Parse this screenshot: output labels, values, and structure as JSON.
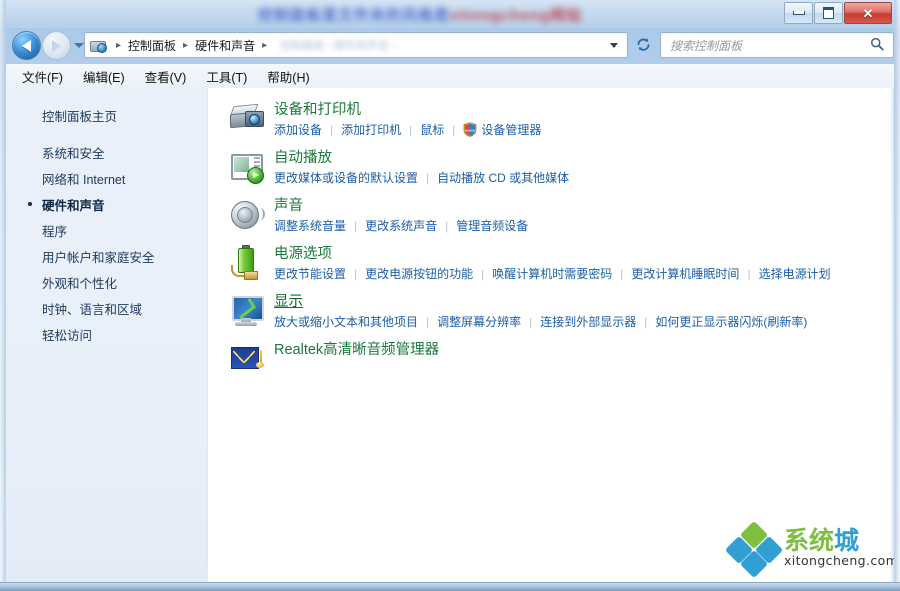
{
  "window": {
    "title_watermark_part1": "控制面板里文件夹的风格是",
    "title_watermark_part2": "xitongcheng网站",
    "minimize_label": "最小化",
    "maximize_label": "最大化",
    "close_label": "✕"
  },
  "nav": {
    "back_label": "后退",
    "forward_label": "前进",
    "history_label": "最近浏览的位置",
    "refresh_label": "刷新",
    "breadcrumbs": [
      "控制面板",
      "硬件和声音"
    ],
    "separator": "▸",
    "address_faint_text": "控制面板 › 硬件和声音 ›"
  },
  "search": {
    "placeholder": "搜索控制面板",
    "icon": "search-icon"
  },
  "menubar": {
    "items": [
      {
        "label": "文件(F)"
      },
      {
        "label": "编辑(E)"
      },
      {
        "label": "查看(V)"
      },
      {
        "label": "工具(T)"
      },
      {
        "label": "帮助(H)"
      }
    ]
  },
  "sidebar": {
    "home": "控制面板主页",
    "items": [
      {
        "label": "系统和安全",
        "current": false
      },
      {
        "label": "网络和 Internet",
        "current": false
      },
      {
        "label": "硬件和声音",
        "current": true
      },
      {
        "label": "程序",
        "current": false
      },
      {
        "label": "用户帐户和家庭安全",
        "current": false
      },
      {
        "label": "外观和个性化",
        "current": false
      },
      {
        "label": "时钟、语言和区域",
        "current": false
      },
      {
        "label": "轻松访问",
        "current": false
      }
    ]
  },
  "categories": [
    {
      "icon": "devices-and-printers-icon",
      "title": "设备和打印机",
      "hovered": false,
      "links": [
        {
          "label": "添加设备",
          "shield": false
        },
        {
          "label": "添加打印机",
          "shield": false
        },
        {
          "label": "鼠标",
          "shield": false
        },
        {
          "label": "设备管理器",
          "shield": true
        }
      ]
    },
    {
      "icon": "autoplay-icon",
      "title": "自动播放",
      "hovered": false,
      "links": [
        {
          "label": "更改媒体或设备的默认设置",
          "shield": false
        },
        {
          "label": "自动播放 CD 或其他媒体",
          "shield": false
        }
      ]
    },
    {
      "icon": "sound-icon",
      "title": "声音",
      "hovered": false,
      "links": [
        {
          "label": "调整系统音量",
          "shield": false
        },
        {
          "label": "更改系统声音",
          "shield": false
        },
        {
          "label": "管理音频设备",
          "shield": false
        }
      ]
    },
    {
      "icon": "power-options-icon",
      "title": "电源选项",
      "hovered": false,
      "links": [
        {
          "label": "更改节能设置",
          "shield": false
        },
        {
          "label": "更改电源按钮的功能",
          "shield": false
        },
        {
          "label": "唤醒计算机时需要密码",
          "shield": false
        },
        {
          "label": "更改计算机睡眠时间",
          "shield": false
        },
        {
          "label": "选择电源计划",
          "shield": false
        }
      ]
    },
    {
      "icon": "display-icon",
      "title": "显示",
      "hovered": true,
      "links": [
        {
          "label": "放大或缩小文本和其他项目",
          "shield": false
        },
        {
          "label": "调整屏幕分辨率",
          "shield": false
        },
        {
          "label": "连接到外部显示器",
          "shield": false
        },
        {
          "label": "如何更正显示器闪烁(刷新率)",
          "shield": false
        }
      ]
    },
    {
      "icon": "realtek-audio-icon",
      "title": "Realtek高清晰音频管理器",
      "hovered": false,
      "links": []
    }
  ],
  "brand": {
    "cn_part1": "系",
    "cn_part2": "统",
    "cn_part3": "城",
    "domain": "xitongcheng.com"
  },
  "colors": {
    "title_green": "#1a7a3c",
    "link_blue": "#1c5fa8",
    "sidebar_bg": "#e8eff9",
    "accent_blue": "#2f9fd4",
    "accent_green": "#7fbf3f"
  }
}
